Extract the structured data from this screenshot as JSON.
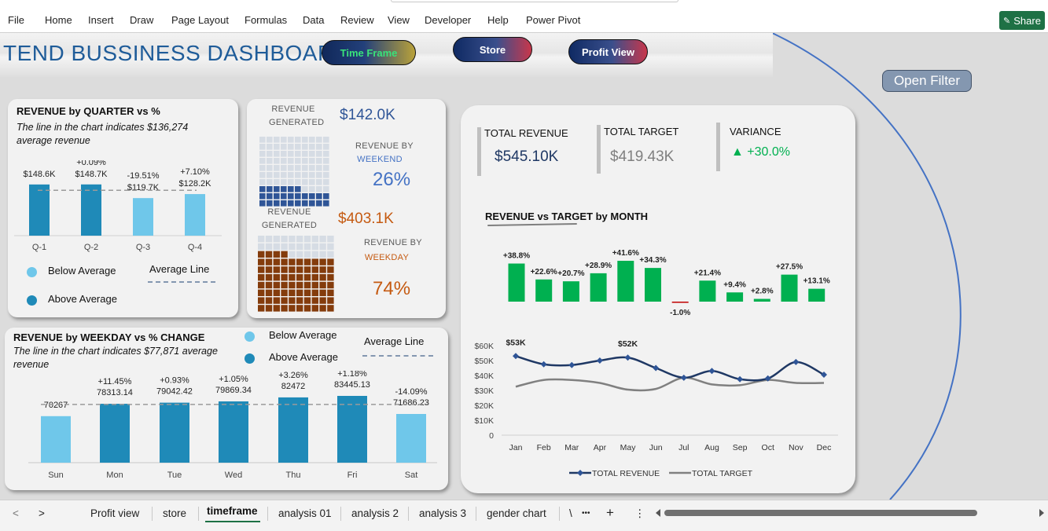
{
  "ribbon": {
    "menus": [
      "File",
      "Home",
      "Insert",
      "Draw",
      "Page Layout",
      "Formulas",
      "Data",
      "Review",
      "View",
      "Developer",
      "Help",
      "Power Pivot"
    ],
    "share_label": "Share"
  },
  "dashboard": {
    "title": "TEND BUSSINESS DASHBOARD",
    "slicers": {
      "time_frame": "Time Frame",
      "store": "Store",
      "profit_view": "Profit View"
    },
    "open_filter": "Open Filter"
  },
  "quarter_card": {
    "title": "REVENUE by QUARTER vs %",
    "note": "The line in the chart indicates $136,274 average revenue",
    "legend_below": "Below Average",
    "legend_above": "Above Average",
    "legend_line": "Average Line",
    "colors": {
      "below": "#6fc7ea",
      "above": "#1f8ab8"
    }
  },
  "waffle_card": {
    "weekend_generated_label": "REVENUE GENERATED",
    "weekend_value": "$142.0K",
    "weekend_label_1": "REVENUE BY",
    "weekend_label_2": "WEEKEND",
    "weekend_pct": "26%",
    "weekday_generated_label": "REVENUE GENERATED",
    "weekday_value": "$403.1K",
    "weekday_label_1": "REVENUE BY",
    "weekday_label_2": "WEEKDAY",
    "weekday_pct": "74%",
    "weekend_fill_fraction": 0.26,
    "weekday_fill_fraction": 0.74,
    "colors": {
      "weekend": "#2f5597",
      "weekday": "#843c0c",
      "empty": "#d6dce4",
      "weekend_text": "#4472c4",
      "weekday_text": "#c55a11"
    }
  },
  "weekday_card": {
    "title": "REVENUE by WEEKDAY vs % CHANGE",
    "note": "The line in the chart indicates $77,871 average revenue",
    "legend_below": "Below Average",
    "legend_above": "Above Average",
    "legend_line": "Average Line"
  },
  "kpi": {
    "total_revenue_label": "TOTAL REVENUE",
    "total_revenue_value": "$545.10K",
    "total_target_label": "TOTAL TARGET",
    "total_target_value": "$419.43K",
    "variance_label": "VARIANCE",
    "variance_value": "▲ +30.0%",
    "colors": {
      "revenue": "#1f3864",
      "target": "#808080",
      "variance": "#00b050"
    }
  },
  "month_card": {
    "title": "REVENUE vs TARGET by MONTH",
    "legend_revenue": "TOTAL REVENUE",
    "legend_target": "TOTAL TARGET"
  },
  "chart_data": [
    {
      "type": "bar",
      "title": "REVENUE by QUARTER vs %",
      "categories": [
        "Q-1",
        "Q-2",
        "Q-3",
        "Q-4"
      ],
      "values": [
        148.6,
        148.7,
        119.7,
        128.2
      ],
      "value_labels": [
        "$148.6K",
        "$148.7K",
        "$119.7K",
        "$128.2K"
      ],
      "pct_labels": [
        "",
        "+0.09%",
        "-19.51%",
        "+7.10%"
      ],
      "above_average": [
        true,
        true,
        false,
        false
      ],
      "average": 136.274,
      "ylim": [
        0,
        170
      ]
    },
    {
      "type": "bar",
      "title": "REVENUE by WEEKDAY vs % CHANGE",
      "categories": [
        "Sun",
        "Mon",
        "Tue",
        "Wed",
        "Thu",
        "Fri",
        "Sat"
      ],
      "values": [
        70267,
        78313.14,
        79042.42,
        79869.34,
        82472,
        83445.13,
        71686.23
      ],
      "value_labels": [
        "70267",
        "78313.14",
        "79042.42",
        "79869.34",
        "82472",
        "83445.13",
        "71686.23"
      ],
      "pct_labels": [
        "",
        "+11.45%",
        "+0.93%",
        "+1.05%",
        "+3.26%",
        "+1.18%",
        "-14.09%"
      ],
      "above_average": [
        false,
        true,
        true,
        true,
        true,
        true,
        false
      ],
      "average": 77871,
      "ylim": [
        0,
        90000
      ]
    },
    {
      "type": "bar",
      "title": "REVENUE vs TARGET by MONTH",
      "categories": [
        "Jan",
        "Feb",
        "Mar",
        "Apr",
        "May",
        "Jun",
        "Jul",
        "Aug",
        "Sep",
        "Oct",
        "Nov",
        "Dec"
      ],
      "values": [
        38.8,
        22.6,
        20.7,
        28.9,
        41.6,
        34.3,
        -1.0,
        21.4,
        9.4,
        2.8,
        27.5,
        13.1
      ],
      "value_labels": [
        "+38.8%",
        "+22.6%",
        "+20.7%",
        "+28.9%",
        "+41.6%",
        "+34.3%",
        "-1.0%",
        "+21.4%",
        "+9.4%",
        "+2.8%",
        "+27.5%",
        "+13.1%"
      ]
    },
    {
      "type": "line",
      "x": [
        "Jan",
        "Feb",
        "Mar",
        "Apr",
        "May",
        "Jun",
        "Jul",
        "Aug",
        "Sep",
        "Oct",
        "Nov",
        "Dec"
      ],
      "yticks": [
        "$60K",
        "$50K",
        "$40K",
        "$30K",
        "$20K",
        "$10K",
        "0"
      ],
      "ylim": [
        0,
        60
      ],
      "series": [
        {
          "name": "TOTAL REVENUE",
          "color": "#1f3864",
          "values": [
            53,
            47.5,
            47,
            50,
            52,
            45,
            38.5,
            43,
            37.5,
            38,
            49,
            40.5
          ]
        },
        {
          "name": "TOTAL TARGET",
          "color": "#808080",
          "values": [
            32.5,
            37,
            37,
            35,
            30.5,
            31,
            38.5,
            34,
            33.5,
            37,
            35,
            35
          ]
        }
      ],
      "annotations": [
        "$53K",
        "$52K"
      ]
    }
  ],
  "tabs": {
    "sheets": [
      "Profit view",
      "store",
      "timeframe",
      "analysis 01",
      "analysis 2",
      "analysis 3",
      "gender chart"
    ],
    "active": "timeframe",
    "overflow": "\\",
    "more": "•••",
    "add": "+",
    "options": "⋮"
  }
}
